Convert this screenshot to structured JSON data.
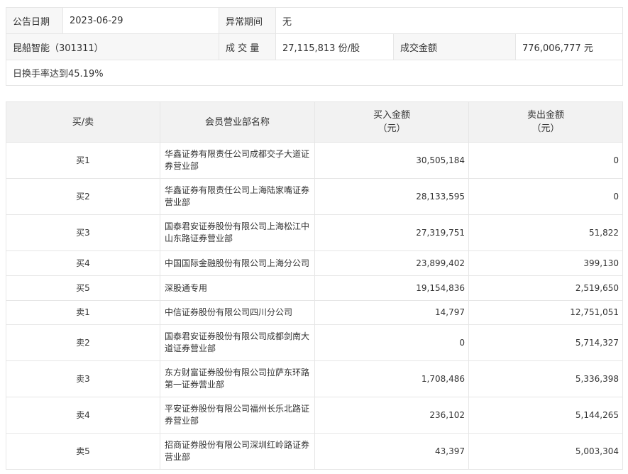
{
  "info": {
    "date_label": "公告日期",
    "date_value": "2023-06-29",
    "period_label": "异常期间",
    "period_value": "无",
    "stock": "昆船智能（301311）",
    "volume_label": "成 交 量",
    "volume_value": "27,115,813 份/股",
    "amount_label": "成交金额",
    "amount_value": "776,006,777 元",
    "reason": "日换手率达到45.19%"
  },
  "table": {
    "headers": {
      "side": "买/卖",
      "member": "会员营业部名称",
      "buy": "买入金额\n（元）",
      "sell": "卖出金额\n（元）"
    },
    "rows": [
      {
        "side": "买1",
        "member": "华鑫证券有限责任公司成都交子大道证券营业部",
        "buy": "30,505,184",
        "sell": "0"
      },
      {
        "side": "买2",
        "member": "华鑫证券有限责任公司上海陆家嘴证券营业部",
        "buy": "28,133,595",
        "sell": "0"
      },
      {
        "side": "买3",
        "member": "国泰君安证券股份有限公司上海松江中山东路证券营业部",
        "buy": "27,319,751",
        "sell": "51,822"
      },
      {
        "side": "买4",
        "member": "中国国际金融股份有限公司上海分公司",
        "buy": "23,899,402",
        "sell": "399,130"
      },
      {
        "side": "买5",
        "member": "深股通专用",
        "buy": "19,154,836",
        "sell": "2,519,650"
      },
      {
        "side": "卖1",
        "member": "中信证券股份有限公司四川分公司",
        "buy": "14,797",
        "sell": "12,751,051"
      },
      {
        "side": "卖2",
        "member": "国泰君安证券股份有限公司成都剑南大道证券营业部",
        "buy": "0",
        "sell": "5,714,327"
      },
      {
        "side": "卖3",
        "member": "东方财富证券股份有限公司拉萨东环路第一证券营业部",
        "buy": "1,708,486",
        "sell": "5,336,398"
      },
      {
        "side": "卖4",
        "member": "平安证券股份有限公司福州长乐北路证券营业部",
        "buy": "236,102",
        "sell": "5,144,265"
      },
      {
        "side": "卖5",
        "member": "招商证券股份有限公司深圳红岭路证券营业部",
        "buy": "43,397",
        "sell": "5,003,304"
      }
    ]
  }
}
